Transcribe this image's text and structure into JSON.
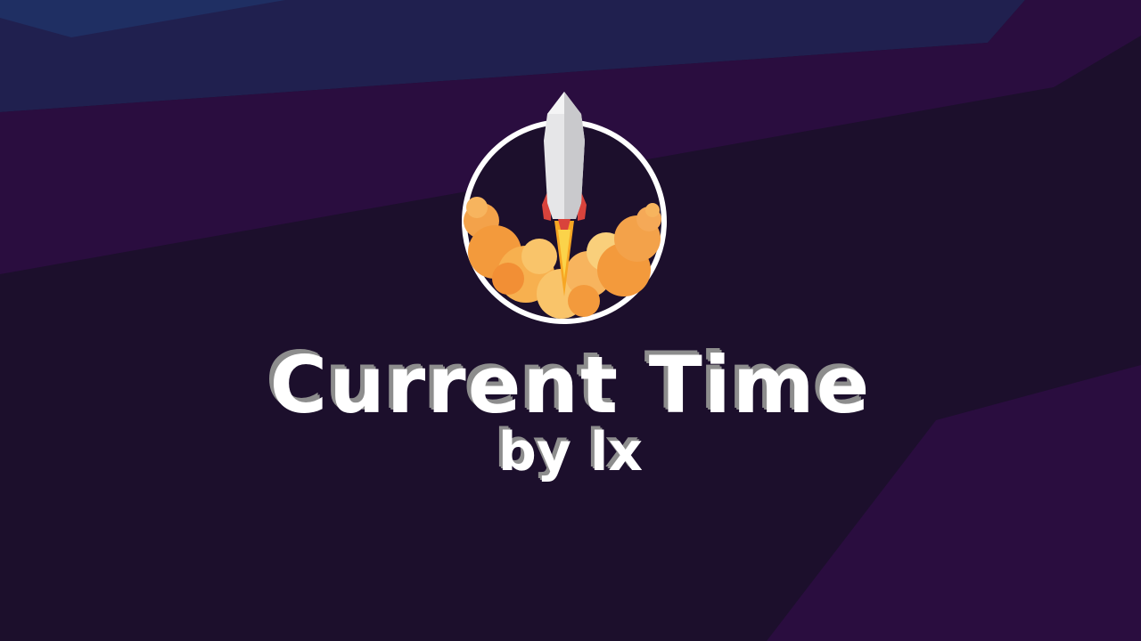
{
  "title": "Current Time",
  "subtitle": "by lx",
  "logo_icon": "rocket-launch-icon",
  "colors": {
    "background": "#1c0f2c",
    "title_text": "#ffffff",
    "title_shadow": "#8d8d8d"
  }
}
